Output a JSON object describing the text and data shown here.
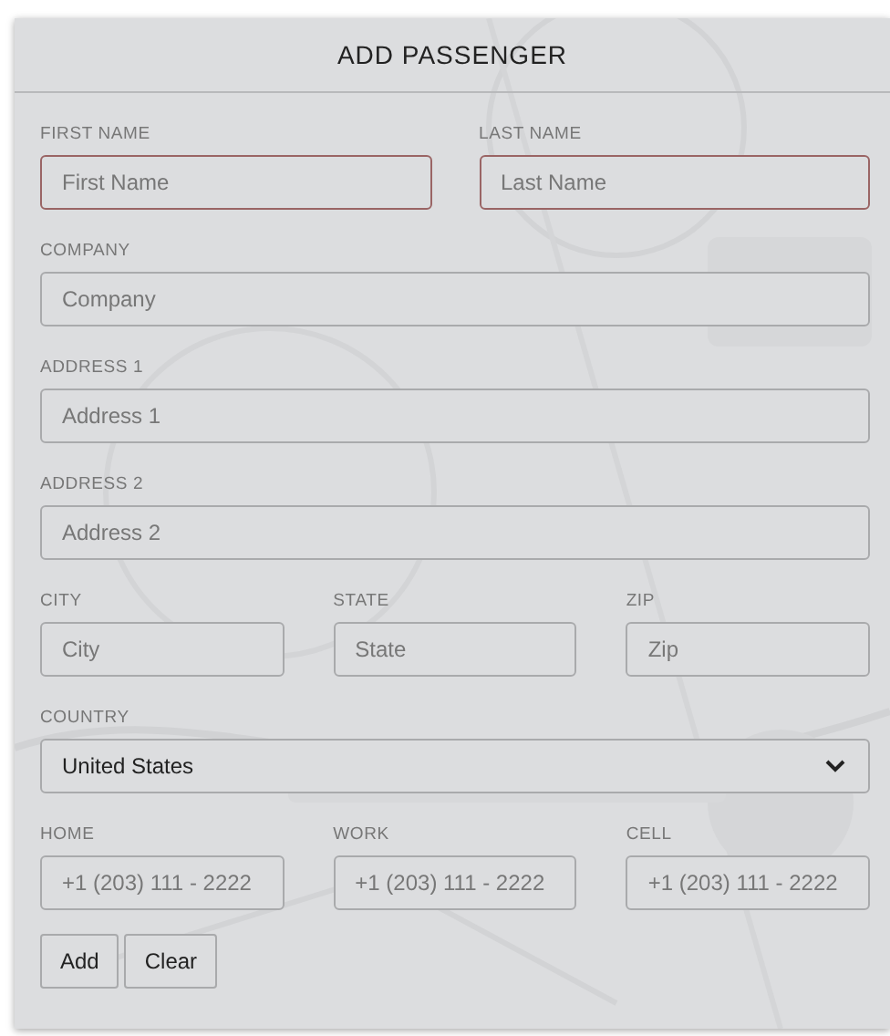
{
  "dialog": {
    "title": "ADD PASSENGER"
  },
  "rows": [
    [
      {
        "kind": "text",
        "label": "FIRST NAME",
        "placeholder": "First Name",
        "invalid": true
      },
      {
        "kind": "text",
        "label": "LAST NAME",
        "placeholder": "Last Name",
        "invalid": true
      }
    ],
    [
      {
        "kind": "text",
        "label": "COMPANY",
        "placeholder": "Company",
        "invalid": false
      }
    ],
    [
      {
        "kind": "text",
        "label": "ADDRESS 1",
        "placeholder": "Address 1",
        "invalid": false
      }
    ],
    [
      {
        "kind": "text",
        "label": "ADDRESS 2",
        "placeholder": "Address 2",
        "invalid": false
      }
    ],
    [
      {
        "kind": "text",
        "label": "CITY",
        "placeholder": "City",
        "invalid": false
      },
      {
        "kind": "text",
        "label": "STATE",
        "placeholder": "State",
        "invalid": false
      },
      {
        "kind": "text",
        "label": "ZIP",
        "placeholder": "Zip",
        "invalid": false
      }
    ],
    [
      {
        "kind": "select",
        "label": "COUNTRY",
        "value": "United States"
      }
    ],
    [
      {
        "kind": "text",
        "label": "HOME",
        "placeholder": "+1 (203) 111 - 2222",
        "invalid": false
      },
      {
        "kind": "text",
        "label": "WORK",
        "placeholder": "+1 (203) 111 - 2222",
        "invalid": false
      },
      {
        "kind": "text",
        "label": "CELL",
        "placeholder": "+1 (203) 111 - 2222",
        "invalid": false
      }
    ]
  ],
  "buttons": [
    "Add",
    "Clear"
  ]
}
